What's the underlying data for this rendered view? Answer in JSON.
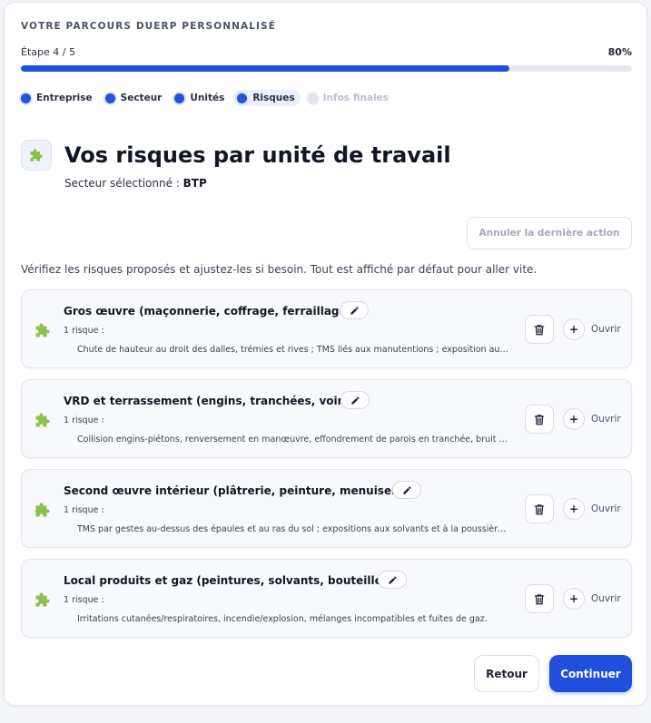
{
  "header": {
    "kicker": "VOTRE PARCOURS DUERP PERSONNALISÉ",
    "step_label": "Étape 4 / 5",
    "progress_percent_label": "80%",
    "progress_fraction": 0.8
  },
  "steps": [
    {
      "label": "Entreprise",
      "state": "done"
    },
    {
      "label": "Secteur",
      "state": "done"
    },
    {
      "label": "Unités",
      "state": "done"
    },
    {
      "label": "Risques",
      "state": "current"
    },
    {
      "label": "Infos finales",
      "state": "disabled"
    }
  ],
  "page": {
    "title": "Vos risques par unité de travail",
    "sector_prefix": "Secteur sélectionné :",
    "sector_value": "BTP",
    "undo_label": "Annuler la dernière action",
    "intro": "Vérifiez les risques proposés et ajustez-les si besoin. Tout est affiché par défaut pour aller vite."
  },
  "units": [
    {
      "title": "Gros œuvre (maçonnerie, coffrage, ferraillage)",
      "count": "1 risque :",
      "description": "Chute de hauteur au droit des dalles, trémies et rives ; TMS liés aux manutentions ; exposition aux poussières de ciment et silice",
      "open_label": "Ouvrir"
    },
    {
      "title": "VRD et terrassement (engins, tranchées, voirie)",
      "count": "1 risque :",
      "description": "Collision engins-piétons, renversement en manœuvre, effondrement de parois en tranchée, bruit et vibrations",
      "open_label": "Ouvrir"
    },
    {
      "title": "Second œuvre intérieur (plâtrerie, peinture, menuiserie)",
      "count": "1 risque :",
      "description": "TMS par gestes au-dessus des épaules et au ras du sol ; expositions aux solvants et à la poussière de plâtre",
      "open_label": "Ouvrir"
    },
    {
      "title": "Local produits et gaz (peintures, solvants, bouteilles)",
      "count": "1 risque :",
      "description": "Irritations cutanées/respiratoires, incendie/explosion, mélanges incompatibles et fuites de gaz.",
      "open_label": "Ouvrir"
    }
  ],
  "footer": {
    "back_label": "Retour",
    "next_label": "Continuer"
  },
  "colors": {
    "accent": "#1f4fdc",
    "puzzle_icon": "#8bc34a"
  },
  "icons": {
    "hero": "puzzle-piece-icon",
    "unit": "puzzle-piece-icon",
    "edit": "pencil-icon",
    "delete": "trash-icon",
    "open": "plus-icon"
  }
}
